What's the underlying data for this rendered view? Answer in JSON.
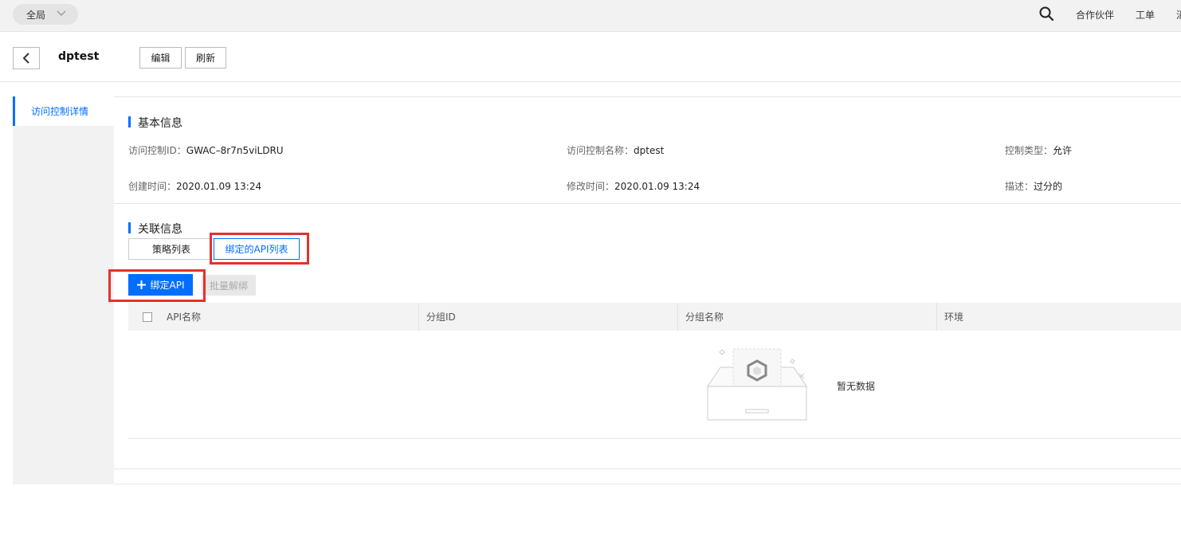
{
  "topbar": {
    "region": "全局",
    "links": [
      "合作伙伴",
      "工单",
      "消"
    ]
  },
  "header": {
    "title": "dptest",
    "edit_label": "编辑",
    "refresh_label": "刷新"
  },
  "sidebar": {
    "items": [
      {
        "label": "访问控制详情",
        "active": true
      }
    ]
  },
  "basic_info": {
    "title": "基本信息",
    "fields": [
      {
        "label": "访问控制ID：",
        "value": "GWAC–8r7n5viLDRU"
      },
      {
        "label": "访问控制名称：",
        "value": "dptest"
      },
      {
        "label": "控制类型：",
        "value": "允许"
      },
      {
        "label": "创建时间：",
        "value": "2020.01.09 13:24"
      },
      {
        "label": "修改时间：",
        "value": "2020.01.09 13:24"
      },
      {
        "label": "描述：",
        "value": "过分的"
      }
    ]
  },
  "related_info": {
    "title": "关联信息",
    "tabs": [
      {
        "label": "策略列表",
        "active": false
      },
      {
        "label": "绑定的API列表",
        "active": true
      }
    ],
    "bind_button": "绑定API",
    "batch_unbind_button": "批量解绑",
    "table": {
      "columns": [
        "API名称",
        "分组ID",
        "分组名称",
        "环境"
      ],
      "empty_text": "暂无数据"
    }
  },
  "colors": {
    "primary": "#006eff",
    "highlight": "#e2322c",
    "topbar_bg": "#f2f2f2"
  }
}
